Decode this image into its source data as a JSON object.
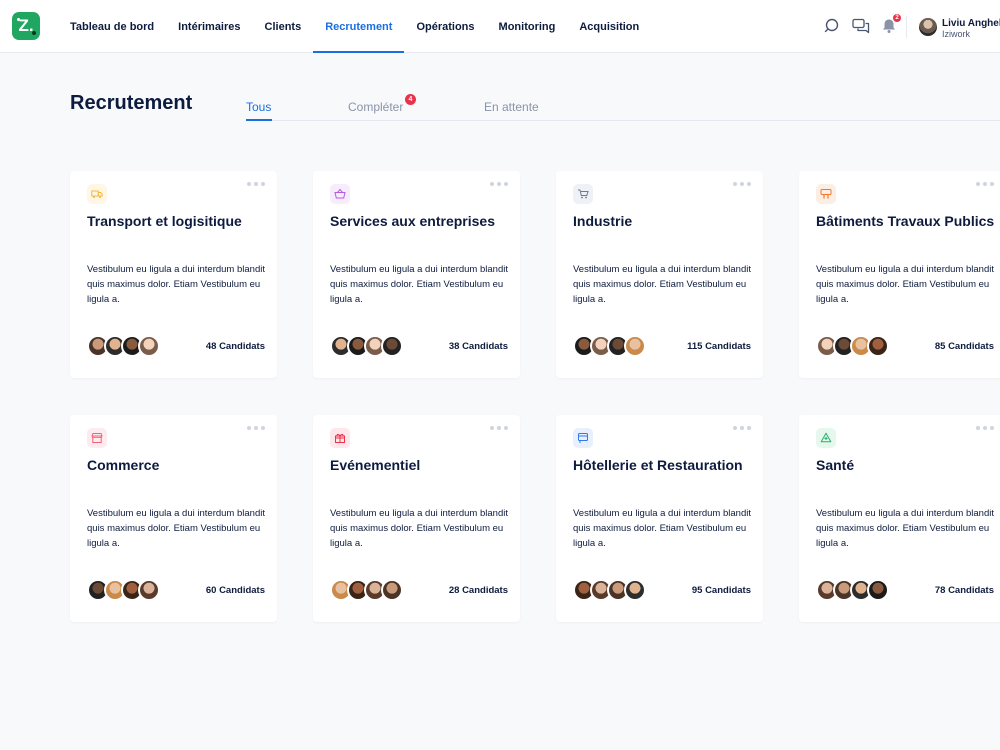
{
  "header": {
    "logo": "Z.",
    "nav": [
      {
        "label": "Tableau de bord"
      },
      {
        "label": "Intérimaires"
      },
      {
        "label": "Clients"
      },
      {
        "label": "Recrutement",
        "active": true
      },
      {
        "label": "Opérations"
      },
      {
        "label": "Monitoring"
      },
      {
        "label": "Acquisition"
      }
    ],
    "notifications_count": "2",
    "user": {
      "name": "Liviu Anghel",
      "org": "Iziwork"
    }
  },
  "page": {
    "title": "Recrutement",
    "tabs": [
      {
        "label": "Tous",
        "active": true
      },
      {
        "label": "Compléter",
        "badge": "4"
      },
      {
        "label": "En attente"
      }
    ]
  },
  "colors": {
    "accent": "#1a6fe0",
    "brand": "#1fa661",
    "badge": "#e8334a"
  },
  "cards": [
    {
      "title": "Transport et logisitique",
      "icon": "truck-icon",
      "icon_color": "#f5b83d",
      "icon_bg": "#fff6e6",
      "description": "Vestibulum eu ligula a dui interdum blandit quis maximus dolor. Etiam Vestibulum eu ligula a.",
      "candidates": "48 Candidats"
    },
    {
      "title": "Services aux entreprises",
      "icon": "basket-icon",
      "icon_color": "#b45be0",
      "icon_bg": "#f7ecfc",
      "description": "Vestibulum eu ligula a dui interdum blandit quis maximus dolor. Etiam Vestibulum eu ligula a.",
      "candidates": "38 Candidats"
    },
    {
      "title": "Industrie",
      "icon": "cart-icon",
      "icon_color": "#6b7a99",
      "icon_bg": "#eef1f6",
      "description": "Vestibulum eu ligula a dui interdum blandit quis maximus dolor. Etiam Vestibulum eu ligula a.",
      "candidates": "115 Candidats"
    },
    {
      "title": "Bâtiments Travaux Publics",
      "icon": "tools-icon",
      "icon_color": "#f07a2e",
      "icon_bg": "#fdeee3",
      "description": "Vestibulum eu ligula a dui interdum blandit quis maximus dolor. Etiam Vestibulum eu ligula a.",
      "candidates": "85 Candidats"
    },
    {
      "title": "Commerce",
      "icon": "store-icon",
      "icon_color": "#f0607a",
      "icon_bg": "#fdecef",
      "description": "Vestibulum eu ligula a dui interdum blandit quis maximus dolor. Etiam Vestibulum eu ligula a.",
      "candidates": "60 Candidats"
    },
    {
      "title": "Evénementiel",
      "icon": "gift-icon",
      "icon_color": "#e8334a",
      "icon_bg": "#fde7ea",
      "description": "Vestibulum eu ligula a dui interdum blandit quis maximus dolor. Etiam Vestibulum eu ligula a.",
      "candidates": "28 Candidats"
    },
    {
      "title": "Hôtellerie et Restauration",
      "icon": "card-icon",
      "icon_color": "#2f7ae5",
      "icon_bg": "#e8f0fd",
      "description": "Vestibulum eu ligula a dui interdum blandit quis maximus dolor. Etiam Vestibulum eu ligula a.",
      "candidates": "95 Candidats"
    },
    {
      "title": "Santé",
      "icon": "health-icon",
      "icon_color": "#25b26b",
      "icon_bg": "#e6f7ee",
      "description": "Vestibulum eu ligula a dui interdum blandit quis maximus dolor. Etiam Vestibulum eu ligula a.",
      "candidates": "78 Candidats"
    }
  ]
}
